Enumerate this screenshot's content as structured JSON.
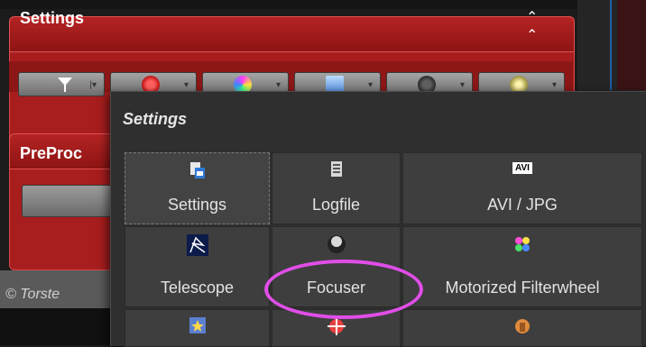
{
  "panel": {
    "title": "Settings"
  },
  "toolbar": {
    "buttons": [
      "filter",
      "target",
      "color",
      "graph",
      "gauge",
      "focus"
    ]
  },
  "preproc": {
    "title": "PreProc"
  },
  "footer": {
    "copyright": "© Torste"
  },
  "popup": {
    "title": "Settings",
    "tiles": [
      {
        "label": "Settings",
        "icon": "settings-icon"
      },
      {
        "label": "Logfile",
        "icon": "logfile-icon"
      },
      {
        "label": "AVI / JPG",
        "icon": "avi-icon"
      },
      {
        "label": "Telescope",
        "icon": "telescope-icon"
      },
      {
        "label": "Focuser",
        "icon": "focuser-icon"
      },
      {
        "label": "Motorized Filterwheel",
        "icon": "filterwheel-icon"
      }
    ],
    "avi_icon_text": "AVI"
  },
  "colors": {
    "panel_red": "#a81d1d",
    "highlight": "#e04ee8"
  }
}
